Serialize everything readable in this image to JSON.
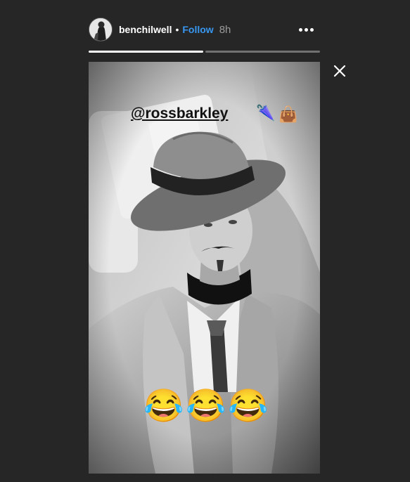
{
  "header": {
    "username": "benchilwell",
    "separator": "•",
    "follow_label": "Follow",
    "time": "8h"
  },
  "progress": {
    "segments": [
      1.0,
      0.0
    ]
  },
  "story": {
    "mention": "@rossbarkley",
    "stickers": [
      "🌂",
      "👜"
    ],
    "laugh_emojis": [
      "😂",
      "😂",
      "😂"
    ]
  },
  "icons": {
    "more": "more-options-icon",
    "close": "close-icon"
  },
  "colors": {
    "background": "#262626",
    "follow": "#3897f0",
    "time": "#9a9a9a"
  }
}
